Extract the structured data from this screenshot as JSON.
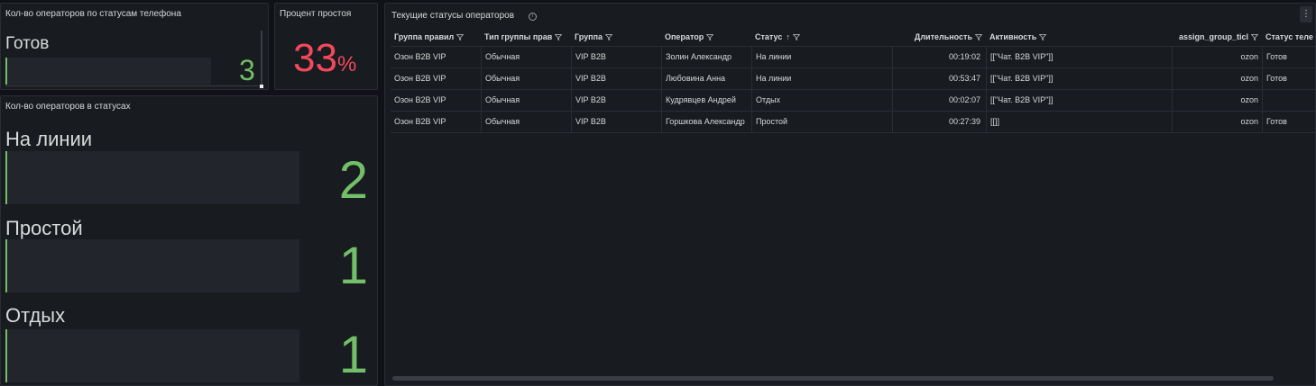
{
  "panel_phone_status": {
    "title": "Кол-во операторов по статусам телефона",
    "label": "Готов",
    "value": "3"
  },
  "panel_idle_percent": {
    "title": "Процент простоя",
    "value": "33",
    "unit": "%"
  },
  "panel_operator_statuses": {
    "title": "Кол-во операторов в статусах",
    "rows": [
      {
        "label": "На линии",
        "value": "2"
      },
      {
        "label": "Простой",
        "value": "1"
      },
      {
        "label": "Отдых",
        "value": "1"
      }
    ]
  },
  "panel_table": {
    "title": "Текущие статусы операторов",
    "columns": [
      "Группа правил",
      "Тип группы прав",
      "Группа",
      "Оператор",
      "Статус",
      "Длительность",
      "Активность",
      "assign_group_ticl",
      "Статус теле"
    ],
    "sort_indicator": "↑",
    "rows": [
      [
        "Озон B2B VIP",
        "Обычная",
        "VIP B2B",
        "Золин Александр",
        "На линии",
        "00:19:02",
        "[[\"Чат. B2B VIP\"]]",
        "ozon",
        "Готов"
      ],
      [
        "Озон B2B VIP",
        "Обычная",
        "VIP B2B",
        "Любовина Анна",
        "На линии",
        "00:53:47",
        "[[\"Чат. B2B VIP\"]]",
        "ozon",
        "Готов"
      ],
      [
        "Озон B2B VIP",
        "Обычная",
        "VIP B2B",
        "Кудрявцев Андрей",
        "Отдых",
        "00:02:07",
        "[[\"Чат. B2B VIP\"]]",
        "ozon",
        ""
      ],
      [
        "Озон B2B VIP",
        "Обычная",
        "VIP B2B",
        "Горшкова Александр",
        "Простой",
        "00:27:39",
        "[[]]",
        "ozon",
        "Готов"
      ]
    ]
  },
  "colors": {
    "green": "#73bf69",
    "red": "#f2495c",
    "panel_bg": "#181b1f",
    "page_bg": "#111217"
  }
}
